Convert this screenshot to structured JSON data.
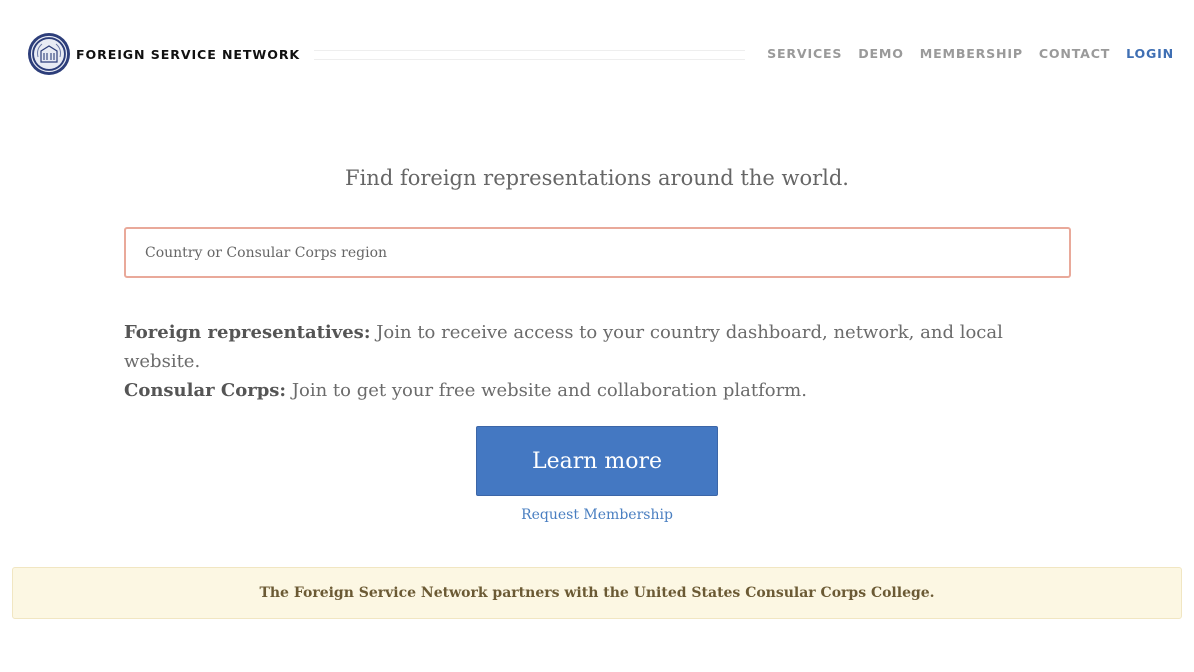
{
  "header": {
    "brand_name": "FOREIGN SERVICE NETWORK",
    "logo_icon": "seal-emblem",
    "nav": [
      {
        "label": "SERVICES"
      },
      {
        "label": "DEMO"
      },
      {
        "label": "MEMBERSHIP"
      },
      {
        "label": "CONTACT"
      },
      {
        "label": "LOGIN"
      }
    ]
  },
  "main": {
    "headline": "Find foreign representations around the world.",
    "search": {
      "placeholder": "Country or Consular Corps region",
      "value": ""
    },
    "info": [
      {
        "label": "Foreign representatives:",
        "text": "Join to receive access to your country dashboard, network, and local website."
      },
      {
        "label": "Consular Corps:",
        "text": "Join to get your free website and collaboration platform."
      }
    ],
    "cta_label": "Learn more",
    "request_link": "Request Membership"
  },
  "banner": {
    "text": "The Foreign Service Network partners with the United States Consular Corps College."
  },
  "colors": {
    "accent": "#4478c2",
    "login": "#3f6fb3",
    "search_border": "#e9a99a",
    "banner_bg": "#fcf7e3",
    "banner_text": "#6b5a34"
  }
}
